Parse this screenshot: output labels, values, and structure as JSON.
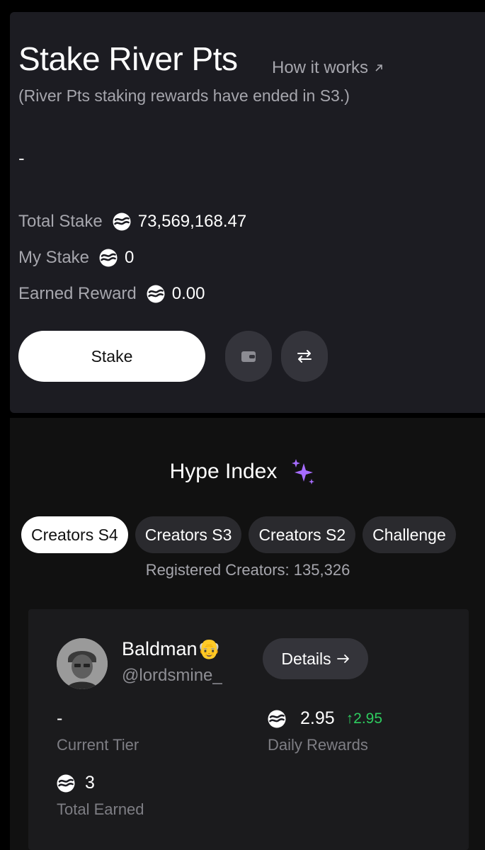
{
  "stake": {
    "title": "Stake River Pts",
    "how_it_works": "How it works",
    "subtitle": "(River Pts staking rewards have ended in S3.)",
    "dash": "-",
    "total_stake_label": "Total Stake",
    "total_stake_value": "73,569,168.47",
    "my_stake_label": "My Stake",
    "my_stake_value": "0",
    "earned_label": "Earned Reward",
    "earned_value": "0.00",
    "stake_button": "Stake",
    "icons": [
      "river-coin-icon",
      "wallet-icon",
      "swap-arrows-icon",
      "external-arrow-icon"
    ]
  },
  "hype": {
    "title": "Hype Index",
    "tabs": [
      "Creators S4",
      "Creators S3",
      "Creators S2",
      "Challenge"
    ],
    "active_tab": "Creators S4",
    "registered": "Registered Creators: 135,326"
  },
  "creator": {
    "name": "Baldman👴",
    "handle": "@lordsmine_",
    "details_button": "Details",
    "tier_value": "-",
    "tier_label": "Current Tier",
    "daily_rewards_value": "2.95",
    "daily_rewards_delta": "2.95",
    "daily_rewards_label": "Daily Rewards",
    "total_earned_value": "3",
    "total_earned_label": "Total Earned"
  },
  "colors": {
    "card_top_bg": "#1c1c22",
    "card_bottom_bg": "#111111",
    "muted_text": "#a6a6ad",
    "positive": "#2ecc5f",
    "sparkle": "#a66cff"
  }
}
